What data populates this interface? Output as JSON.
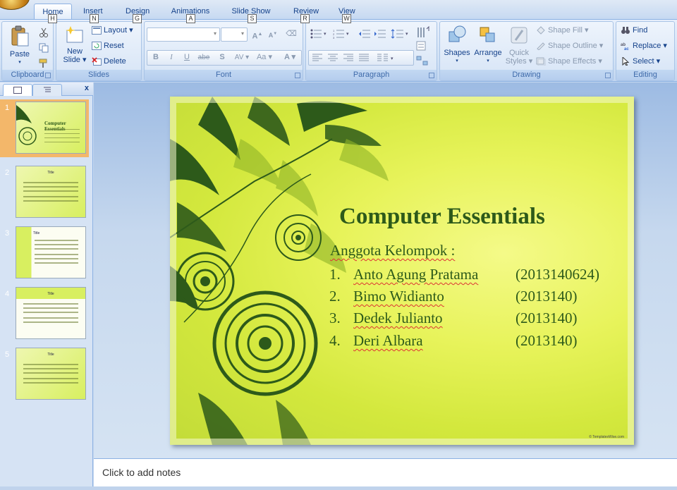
{
  "tabs": [
    {
      "label": "Home",
      "key": "H",
      "active": true
    },
    {
      "label": "Insert",
      "key": "N"
    },
    {
      "label": "Design",
      "key": "G"
    },
    {
      "label": "Animations",
      "key": "A"
    },
    {
      "label": "Slide Show",
      "key": "S"
    },
    {
      "label": "Review",
      "key": "R"
    },
    {
      "label": "View",
      "key": "W"
    }
  ],
  "ribbon": {
    "clipboard": {
      "label": "Clipboard",
      "paste": "Paste"
    },
    "slides": {
      "label": "Slides",
      "new_slide_line1": "New",
      "new_slide_line2": "Slide",
      "layout": "Layout",
      "reset": "Reset",
      "delete": "Delete"
    },
    "font": {
      "label": "Font",
      "bold": "B",
      "italic": "I",
      "underline": "U",
      "strike": "abe",
      "shadow": "S",
      "spacing": "AV",
      "case": "Aa",
      "color": "A"
    },
    "paragraph": {
      "label": "Paragraph"
    },
    "drawing": {
      "label": "Drawing",
      "shapes": "Shapes",
      "arrange": "Arrange",
      "quick_styles_line1": "Quick",
      "quick_styles_line2": "Styles",
      "shape_fill": "Shape Fill",
      "shape_outline": "Shape Outline",
      "shape_effects": "Shape Effects"
    },
    "editing": {
      "label": "Editing",
      "find": "Find",
      "replace": "Replace",
      "select": "Select"
    }
  },
  "slides_panel": {
    "close": "x",
    "thumbnails": [
      {
        "num": "1",
        "title": "Computer Essentials",
        "selected": true
      },
      {
        "num": "2",
        "title": "Title"
      },
      {
        "num": "3",
        "title": "Title"
      },
      {
        "num": "4",
        "title": "Title"
      },
      {
        "num": "5",
        "title": "Title"
      }
    ]
  },
  "slide": {
    "title": "Computer Essentials",
    "subtitle": "Anggota Kelompok   :",
    "members": [
      {
        "num": "1.",
        "name": "Anto Agung  Pratama",
        "id": "(2013140624)"
      },
      {
        "num": "2.",
        "name": "Bimo Widianto",
        "id": "(2013140)"
      },
      {
        "num": "3.",
        "name": "Dedek Julianto",
        "id": "(2013140)"
      },
      {
        "num": "4.",
        "name": "Deri Albara",
        "id": "(2013140)"
      }
    ],
    "credit": "© TemplatesWise.com"
  },
  "notes": {
    "placeholder": "Click to add notes"
  },
  "colors": {
    "title": "#2d5a1a",
    "ribbon_text": "#15428b",
    "slide_bg": "#d8ec44"
  }
}
